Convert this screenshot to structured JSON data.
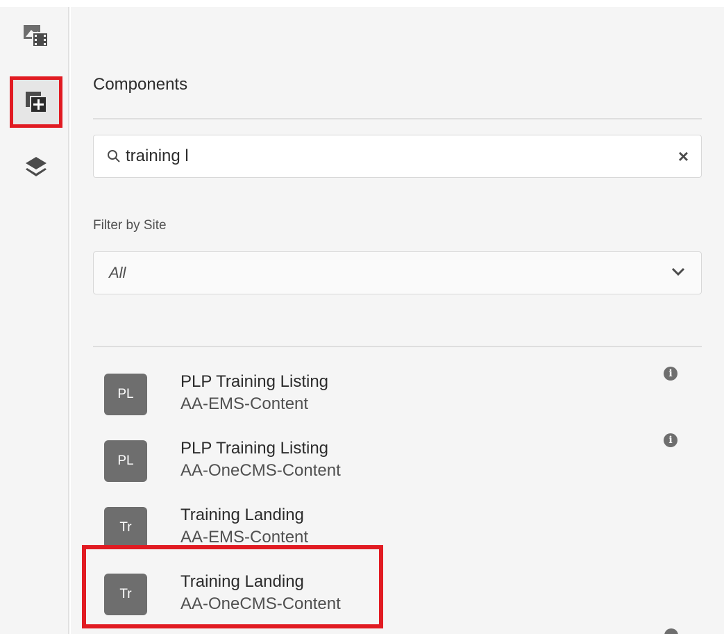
{
  "rail": {
    "items": [
      {
        "icon": "assets-icon"
      },
      {
        "icon": "components-icon",
        "selected": true
      },
      {
        "icon": "content-tree-icon"
      }
    ]
  },
  "panel": {
    "title": "Components",
    "search": {
      "icon": "search-icon",
      "value": "training l",
      "clear_label": "×"
    },
    "filter": {
      "label": "Filter by Site",
      "value": "All"
    }
  },
  "components": [
    {
      "badge": "PL",
      "title": "PLP Training Listing",
      "group": "AA-EMS-Content",
      "info": "i"
    },
    {
      "badge": "PL",
      "title": "PLP Training Listing",
      "group": "AA-OneCMS-Content",
      "info": "i"
    },
    {
      "badge": "Tr",
      "title": "Training Landing",
      "group": "AA-EMS-Content"
    },
    {
      "badge": "Tr",
      "title": "Training Landing",
      "group": "AA-OneCMS-Content"
    }
  ],
  "colors": {
    "highlight": "#e11b22",
    "badge": "#6e6e6e"
  }
}
